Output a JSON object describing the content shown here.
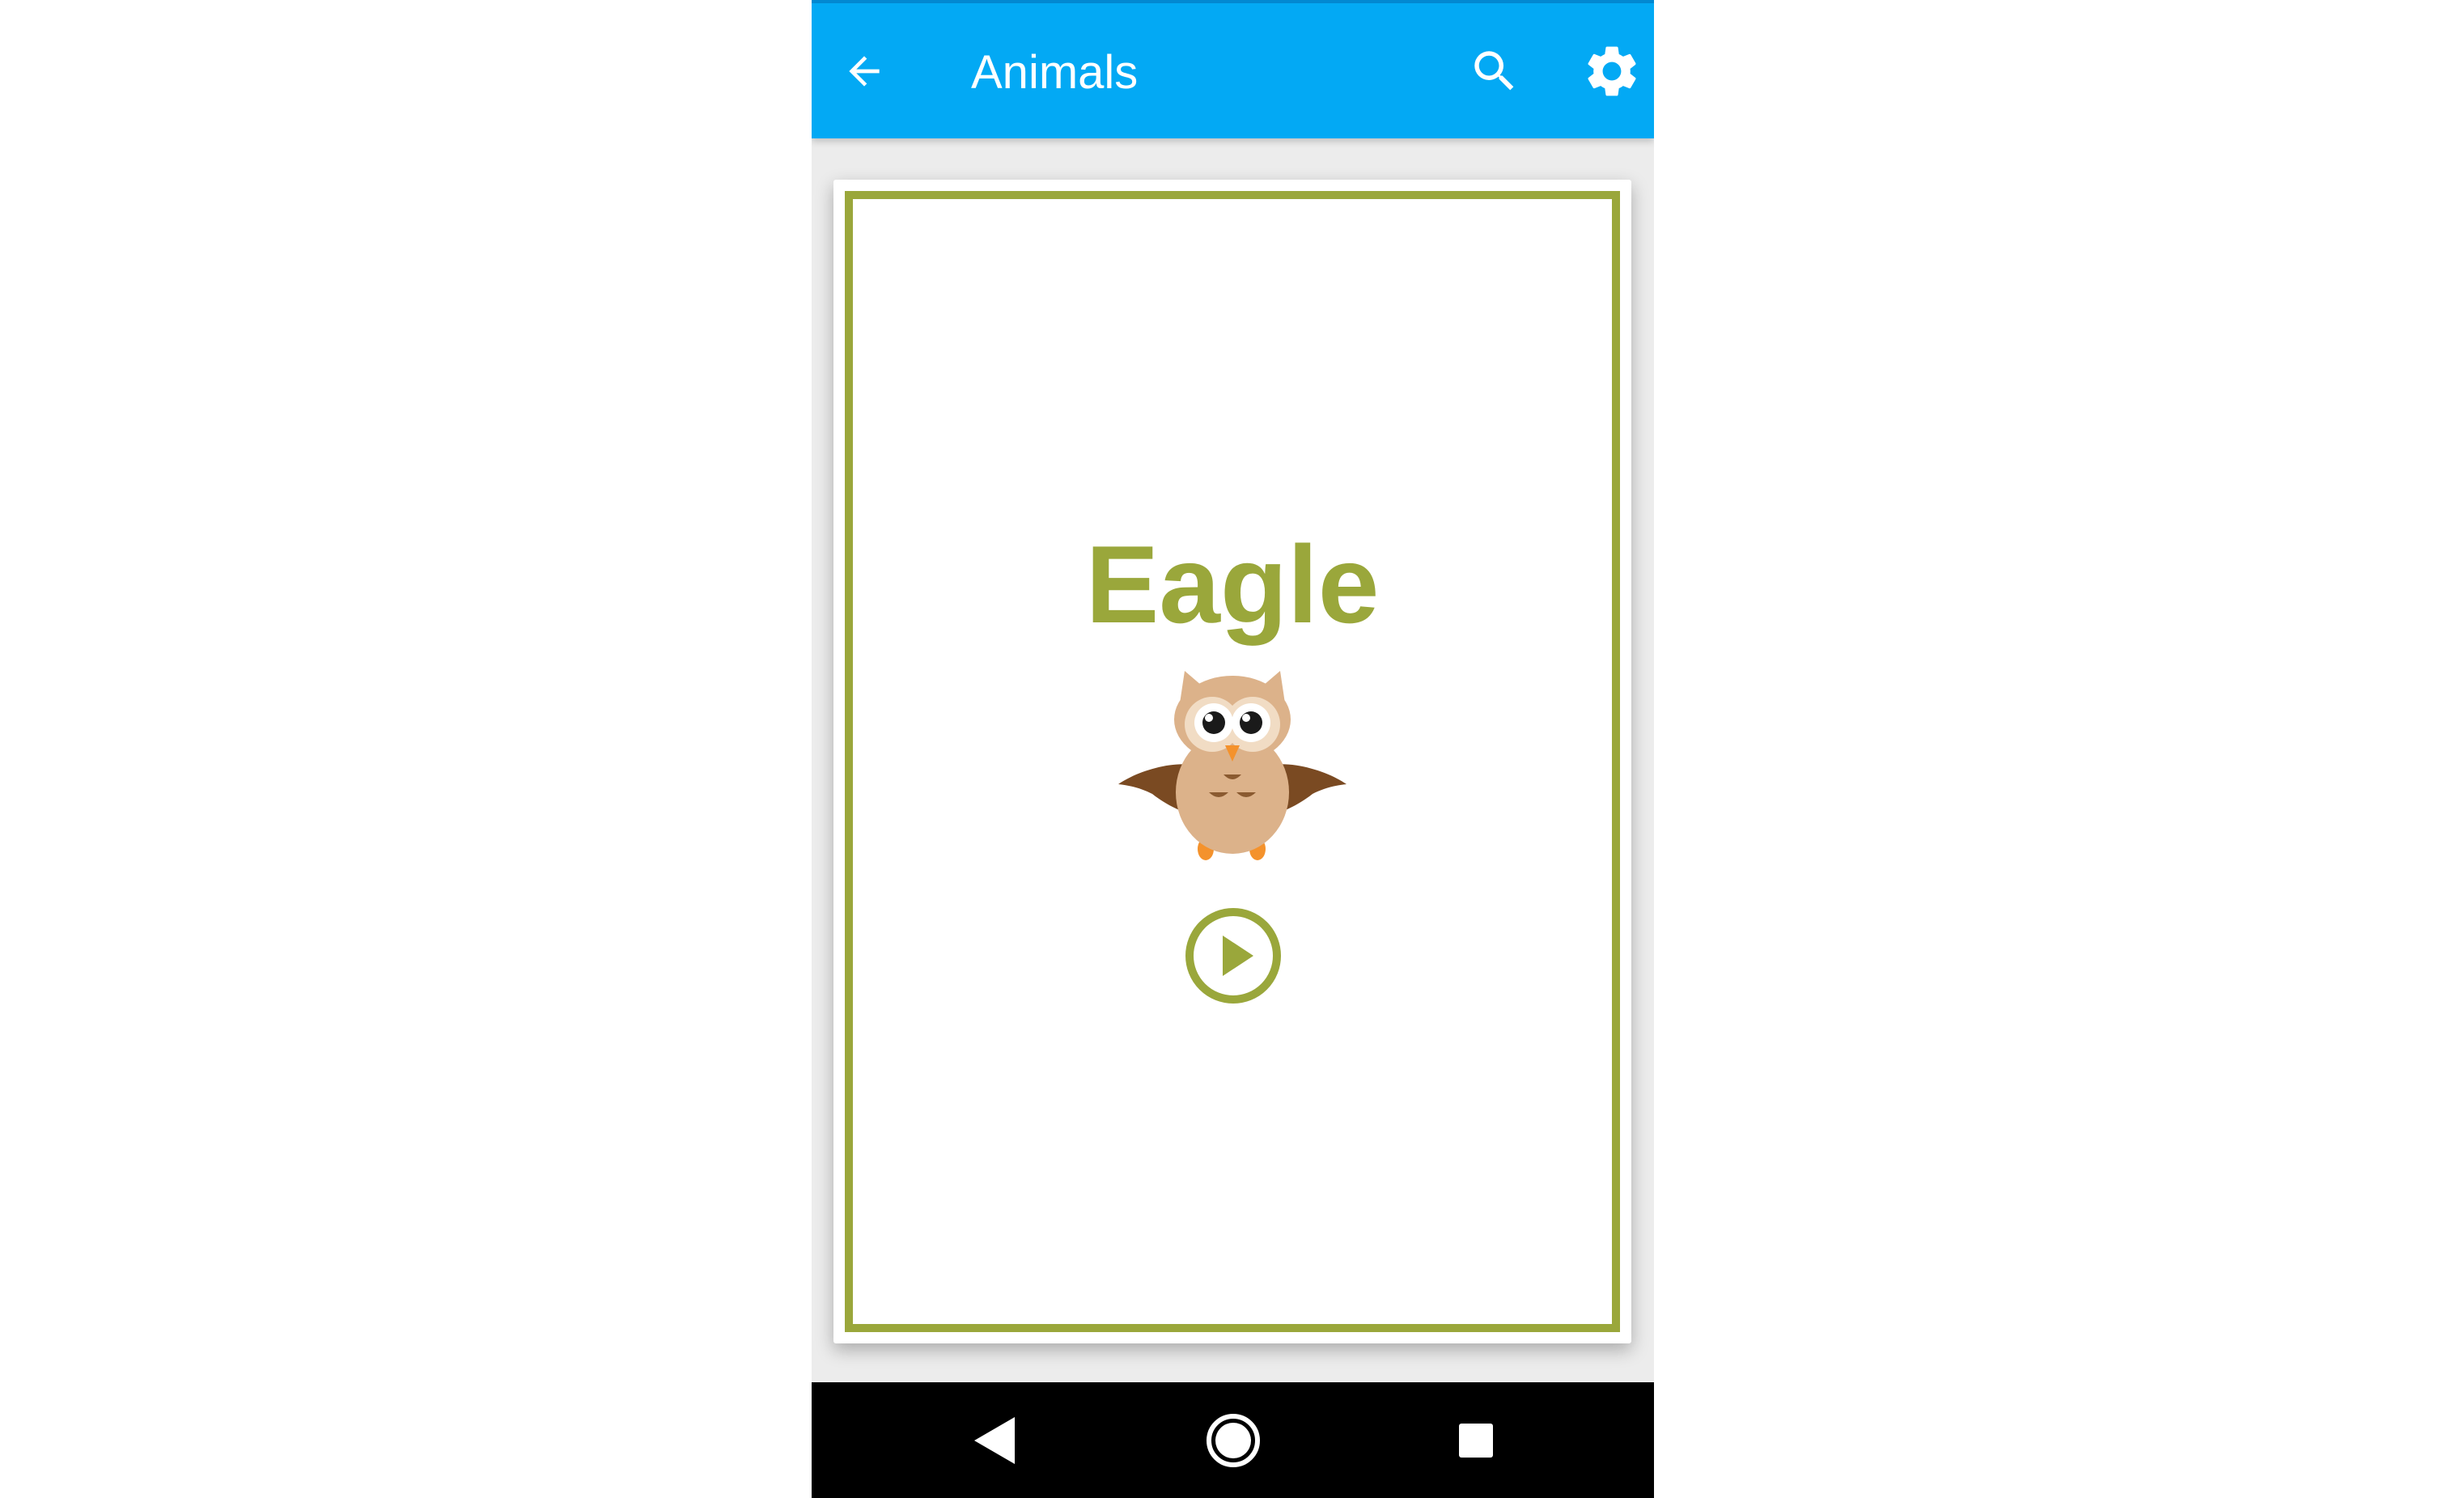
{
  "app_bar": {
    "title": "Animals",
    "back_icon": "arrow-back-icon",
    "search_icon": "search-icon",
    "settings_icon": "gear-icon",
    "background_color": "#03a9f4"
  },
  "card": {
    "word": "Eagle",
    "illustration": "owl-illustration",
    "play_icon": "play-circle-icon",
    "accent_color": "#9aa73b"
  },
  "nav_bar": {
    "back_icon": "triangle-back-icon",
    "home_icon": "circle-home-icon",
    "recents_icon": "square-recents-icon"
  }
}
